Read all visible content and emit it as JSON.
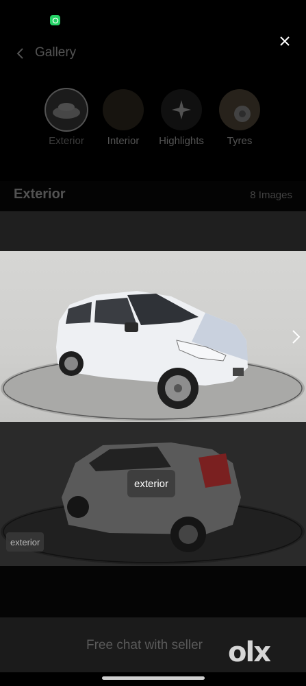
{
  "header": {
    "title": "Gallery"
  },
  "categories": [
    {
      "label": "Exterior",
      "active": true
    },
    {
      "label": "Interior",
      "active": false
    },
    {
      "label": "Highlights",
      "active": false
    },
    {
      "label": "Tyres",
      "active": false
    }
  ],
  "section": {
    "title": "Exterior",
    "count": "8 Images"
  },
  "viewer": {
    "tooltip": "exterior",
    "tag": "exterior"
  },
  "bottom": {
    "chat_label": "Free chat with seller",
    "brand": "olx"
  },
  "colors": {
    "background": "#000000",
    "whatsapp": "#25d366"
  }
}
